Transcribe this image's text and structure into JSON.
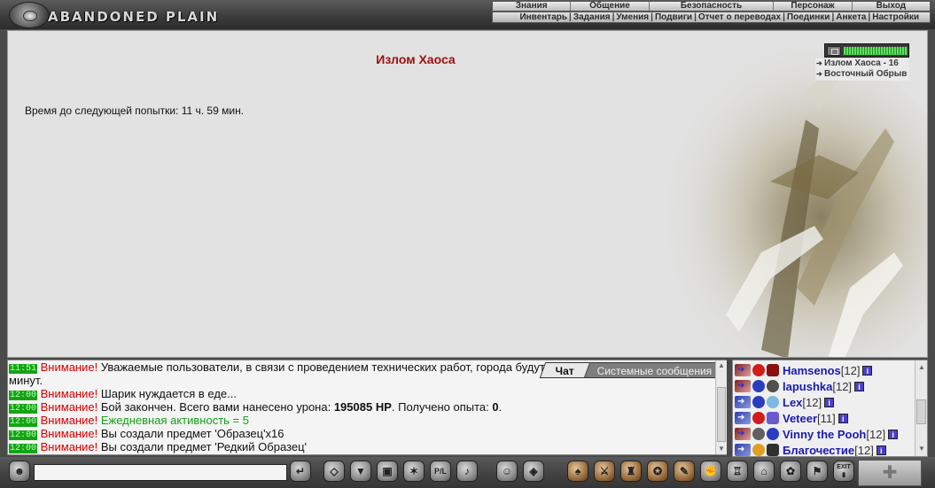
{
  "header": {
    "logo_text": "ABANDONED PLAIN",
    "menu_top": [
      "Знания",
      "Общение",
      "Безопасность",
      "Персонаж",
      "Выход"
    ],
    "menu_bottom": [
      "Инвентарь",
      "Задания",
      "Умения",
      "Подвиги",
      "Отчет о переводах",
      "Поединки",
      "Анкета",
      "Настройки"
    ]
  },
  "location": {
    "title": "Излом Хаоса",
    "timer_text": "Время до следующей попытки: 11 ч. 59 мин.",
    "health_fill": 1.0,
    "links": [
      "Излом Хаоса - 16",
      "Восточный Обрыв"
    ]
  },
  "chat": {
    "tabs": [
      "Чат",
      "Системные сообщения"
    ],
    "active_tab": 0,
    "messages": [
      {
        "time": "11:51",
        "prefix": "Внимание!",
        "text": "Уважаемые пользователи, в связи с проведением технических работ, города будут",
        "cont": "минут."
      },
      {
        "time": "12:00",
        "prefix": "Внимание!",
        "text": "Шарик нуждается в еде..."
      },
      {
        "time": "12:00",
        "prefix": "Внимание!",
        "text_a": "Бой закончен. Всего вами нанесено урона: ",
        "bold_a": "195085 HP",
        "text_b": ". Получено опыта: ",
        "bold_b": "0",
        "text_c": "."
      },
      {
        "time": "12:00",
        "prefix": "Внимание!",
        "text": "Ежедневная активность = 5",
        "green": true
      },
      {
        "time": "12:00",
        "prefix": "Внимание!",
        "text": "Вы создали предмет 'Образец'x16"
      },
      {
        "time": "12:00",
        "prefix": "Внимание!",
        "text": "Вы создали предмет 'Редкий Образец'"
      }
    ],
    "input_value": ""
  },
  "players": [
    {
      "name": "Hamsenos",
      "level": "[12]",
      "info": "i"
    },
    {
      "name": "lapushka",
      "level": "[12]",
      "info": "i"
    },
    {
      "name": "Lex",
      "level": "[12]",
      "info": "i"
    },
    {
      "name": "Veteer",
      "level": "[11]",
      "info": "i"
    },
    {
      "name": "Vinny the Pooh",
      "level": "[12]",
      "info": "i"
    },
    {
      "name": "Благочестие",
      "level": "[12]",
      "info": "i"
    }
  ],
  "toolbar": {
    "send_glyph": "↵",
    "pl_glyph": "P/L",
    "exit_label": "EXIT"
  },
  "colors": {
    "location_title": "#9c1010",
    "warning": "#d40000",
    "green_text": "#17a017",
    "player_name": "#1a1ab0",
    "time_badge": "#14a314"
  }
}
